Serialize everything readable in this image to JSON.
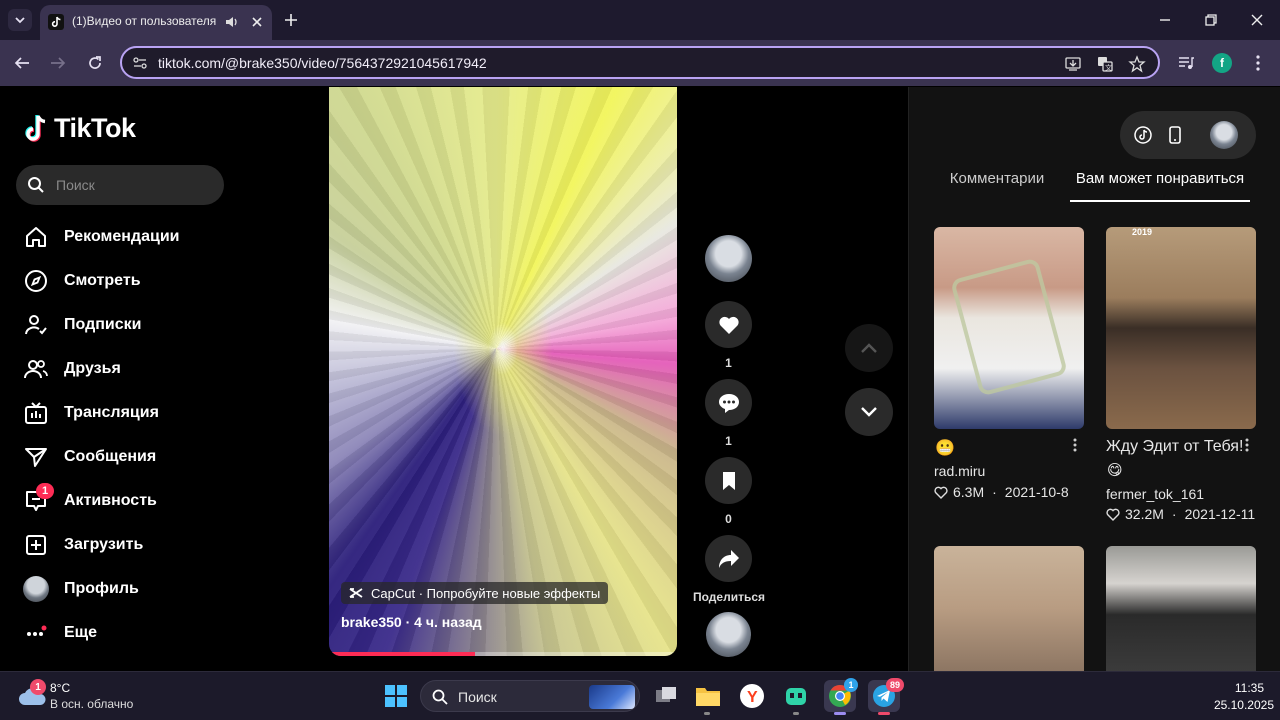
{
  "browser": {
    "tab_title": "(1)Видео от пользователя",
    "url": "tiktok.com/@brake350/video/7564372921045617942",
    "profile_initial": "f"
  },
  "sidebar": {
    "logo": "TikTok",
    "search_placeholder": "Поиск",
    "items": [
      {
        "label": "Рекомендации",
        "icon": "home-icon"
      },
      {
        "label": "Смотреть",
        "icon": "compass-icon"
      },
      {
        "label": "Подписки",
        "icon": "following-icon"
      },
      {
        "label": "Друзья",
        "icon": "friends-icon"
      },
      {
        "label": "Трансляция",
        "icon": "live-icon"
      },
      {
        "label": "Сообщения",
        "icon": "messages-icon"
      },
      {
        "label": "Активность",
        "icon": "activity-icon",
        "badge": "1"
      },
      {
        "label": "Загрузить",
        "icon": "upload-icon"
      },
      {
        "label": "Профиль",
        "icon": "avatar"
      },
      {
        "label": "Еще",
        "icon": "more-icon"
      }
    ]
  },
  "video": {
    "effect_label": "CapCut · Попробуйте новые эффекты",
    "author": "brake350",
    "time": "4 ч. назад",
    "progress": 0.42
  },
  "actions": {
    "likes": "1",
    "comments": "1",
    "saves": "0",
    "share_label": "Поделиться"
  },
  "right_panel": {
    "tabs": [
      "Комментарии",
      "Вам может понравиться"
    ],
    "active_tab": 1,
    "videos": [
      {
        "title": "😬",
        "author": "rad.miru",
        "likes": "6.3M",
        "date": "2021-10-8",
        "badge": ""
      },
      {
        "title": "Жду Эдит от Тебя!",
        "emoji": "😋",
        "author": "fermer_tok_161",
        "likes": "32.2M",
        "date": "2021-12-11",
        "badge": "2019"
      }
    ]
  },
  "taskbar": {
    "weather_temp": "8°C",
    "weather_desc": "В осн. облачно",
    "weather_badge": "1",
    "search": "Поиск",
    "time": "11:35",
    "date": "25.10.2025",
    "chrome_badge": "1",
    "telegram_badge": "89"
  },
  "colors": {
    "accent_pink": "#fe2c55",
    "omnibox_border": "#b9a3f3",
    "chrome_bg": "#3a3350"
  }
}
